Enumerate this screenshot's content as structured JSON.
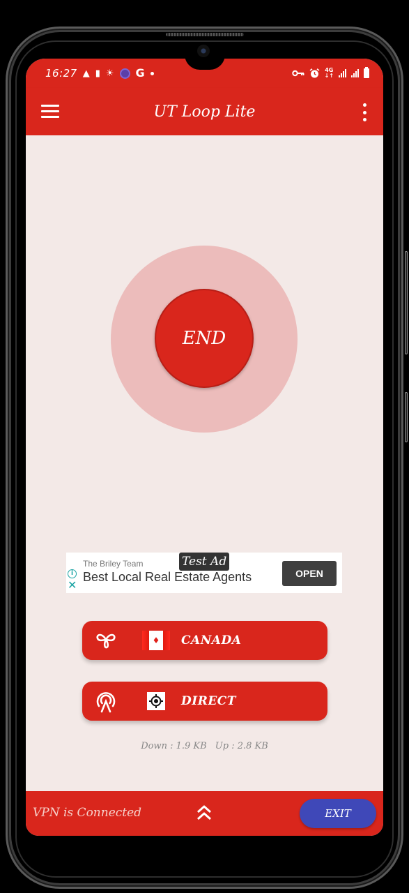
{
  "status_bar": {
    "time": "16:27",
    "left_icons": [
      "warning-icon",
      "sd-card-icon",
      "weather-icon",
      "app-badge-icon",
      "google-icon",
      "dot-icon"
    ],
    "right_icons": [
      "vpn-key-icon",
      "alarm-icon",
      "4g-icon",
      "signal-icon",
      "signal-icon",
      "battery-icon"
    ],
    "network_type_top": "4G",
    "network_type_bottom": "↓↑",
    "google_letter": "G"
  },
  "app_bar": {
    "title": "UT Loop Lite",
    "menu_icon": "hamburger-menu-icon",
    "more_icon": "more-vert-icon"
  },
  "connect_button": {
    "label": "END"
  },
  "ad": {
    "tag": "Test Ad",
    "advertiser": "The Briley Team",
    "headline": "Best Local Real Estate Agents",
    "cta": "OPEN",
    "info_glyph": "i",
    "close_glyph": "✕"
  },
  "server_selector": {
    "icon": "infinity-loop-icon",
    "flag": "canada-flag",
    "label": "CANADA"
  },
  "mode_selector": {
    "icon": "broadcast-icon",
    "mode_icon": "target-icon",
    "label": "DIRECT"
  },
  "traffic": {
    "down": "Down : 1.9 KB",
    "up": "Up : 2.8 KB"
  },
  "bottom_bar": {
    "status": "VPN is Connected",
    "expand_icon": "double-chevron-up-icon",
    "exit_label": "EXIT"
  },
  "colors": {
    "primary": "#d9261c",
    "ring": "#ecbcbb",
    "background": "#f3e9e7",
    "exit_button": "#3f48b8"
  }
}
